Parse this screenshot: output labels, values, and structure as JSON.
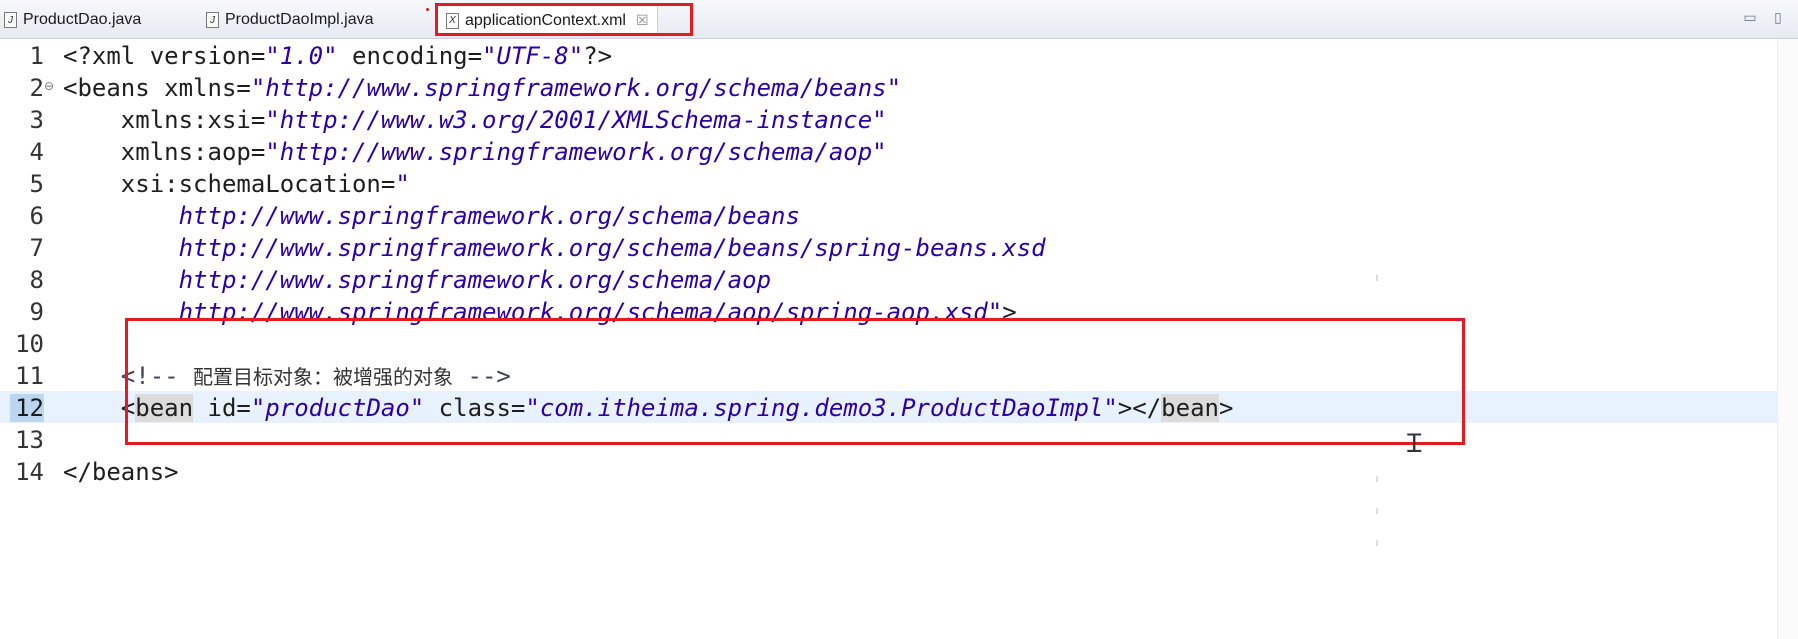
{
  "tabs": [
    {
      "label": "ProductDao.java",
      "icon": "java-file-icon",
      "active": false
    },
    {
      "label": "ProductDaoImpl.java",
      "icon": "java-file-icon",
      "active": false
    },
    {
      "label": "applicationContext.xml",
      "icon": "xml-file-icon",
      "active": true
    }
  ],
  "tab_close_glyph": "☒",
  "window_controls": {
    "minimize": "▭",
    "maximize": "▯"
  },
  "lines": {
    "1": {
      "num": "1",
      "pre": "<?xml ",
      "a1": "version=",
      "s1": "\"1.0\"",
      "a2": " encoding=",
      "s2": "\"UTF-8\"",
      "post": "?>"
    },
    "2": {
      "num": "2",
      "fold": "⊖",
      "pre": "<beans ",
      "a1": "xmlns=",
      "s1": "\"http://www.springframework.org/schema/beans\""
    },
    "3": {
      "num": "3",
      "a1": "    xmlns:xsi=",
      "s1": "\"http://www.w3.org/2001/XMLSchema-instance\""
    },
    "4": {
      "num": "4",
      "a1": "    xmlns:aop=",
      "s1": "\"http://www.springframework.org/schema/aop\""
    },
    "5": {
      "num": "5",
      "a1": "    xsi:schemaLocation=",
      "s1": "\""
    },
    "6": {
      "num": "6",
      "s1": "        http://www.springframework.org/schema/beans"
    },
    "7": {
      "num": "7",
      "s1": "        http://www.springframework.org/schema/beans/spring-beans.xsd"
    },
    "8": {
      "num": "8",
      "s1": "        http://www.springframework.org/schema/aop"
    },
    "9": {
      "num": "9",
      "s1": "        http://www.springframework.org/schema/aop/spring-aop.xsd\"",
      "post": ">"
    },
    "10": {
      "num": "10"
    },
    "11": {
      "num": "11",
      "c1": "    <!-- ",
      "cjk": "配置目标对象：被增强的对象",
      "c2": " -->"
    },
    "12": {
      "num": "12",
      "t1": "    <",
      "w1": "bean",
      "a1": " id=",
      "s1": "\"productDao\"",
      "a2": " class=",
      "s2": "\"com.itheima.spring.demo3.ProductDaoImpl\"",
      "t2": "></",
      "w2": "bean",
      "t3": ">"
    },
    "13": {
      "num": "13"
    },
    "14": {
      "num": "14",
      "pre": "</beans>"
    }
  }
}
